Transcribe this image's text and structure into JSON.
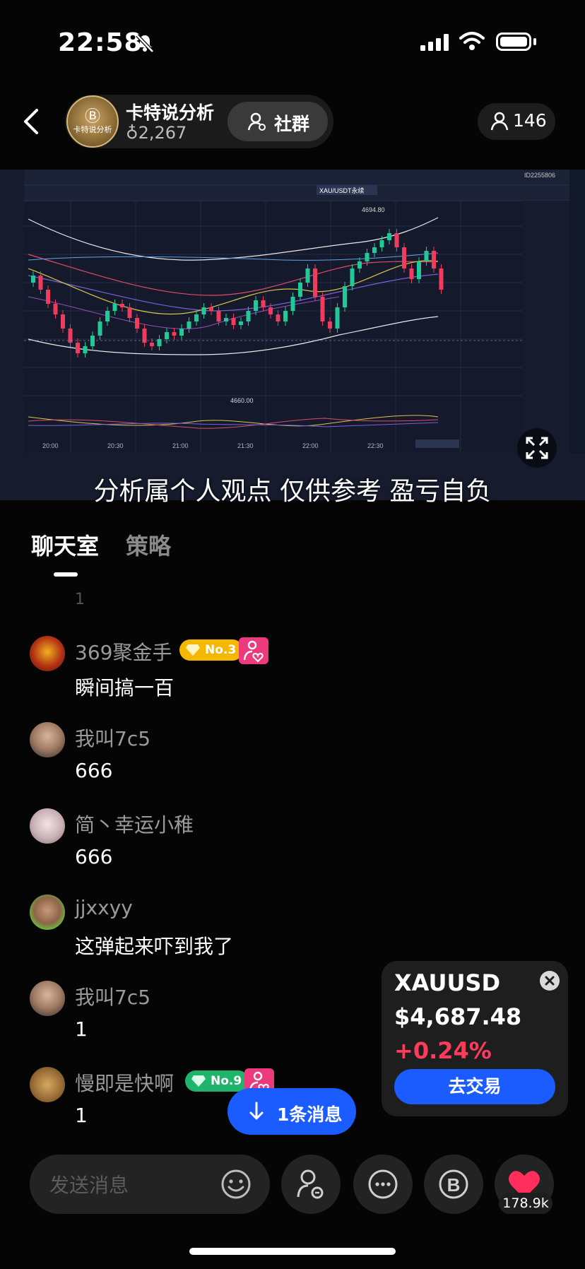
{
  "status_bar": {
    "time": "22:58"
  },
  "header": {
    "host_name": "卡特说分析",
    "host_heat": "2,267",
    "logo_text": "卡特说分析",
    "community_label": "社群",
    "viewer_count": "146"
  },
  "stream": {
    "caption": "分析属个人观点 仅供参考 盈亏自负",
    "chart_symbol": "XAU/USDT永续",
    "chart_id": "ID2255806",
    "price_labels": [
      "4694.80",
      "4660.00"
    ],
    "time_labels": [
      "20:00",
      "20:30",
      "21:00",
      "21:30",
      "22:00",
      "22:30"
    ]
  },
  "tabs": [
    {
      "label": "聊天室"
    },
    {
      "label": "策略"
    }
  ],
  "chat": {
    "faded_text": "1",
    "messages": [
      {
        "name": "369聚金手",
        "text": "瞬间搞一百",
        "badge": "No.3",
        "badge_color": "#f5b800"
      },
      {
        "name": "我叫7c5",
        "text": "666"
      },
      {
        "name": "简丶幸运小稚",
        "text": "666"
      },
      {
        "name": "jjxxyy",
        "text": "这弹起来吓到我了"
      },
      {
        "name": "我叫7c5",
        "text": "1"
      },
      {
        "name": "慢即是快啊",
        "text": "1",
        "badge": "No.9",
        "badge_color": "#1fb36b"
      }
    ]
  },
  "price_card": {
    "symbol": "XAUUSD",
    "price": "$4,687.48",
    "change": "+0.24%",
    "trade_label": "去交易"
  },
  "new_message": {
    "label": "1条消息"
  },
  "bottom_bar": {
    "input_placeholder": "发送消息",
    "like_count": "178.9k"
  }
}
